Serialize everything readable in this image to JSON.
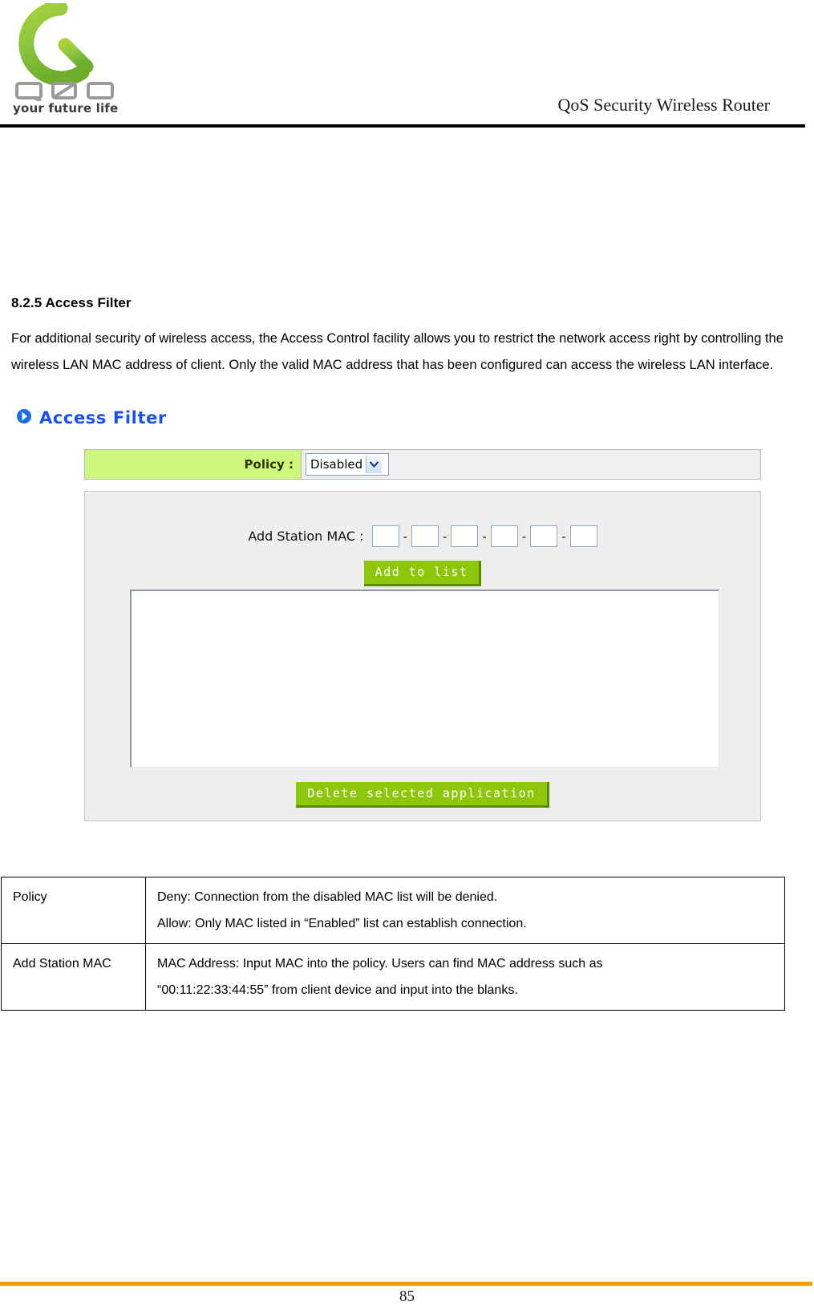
{
  "header": {
    "logo": {
      "mark_icon": "qno-q-logo-icon",
      "wordmark": "QNO",
      "tagline": "your future life"
    },
    "title": "QoS Security Wireless Router"
  },
  "section": {
    "number_title": "8.2.5 Access Filter",
    "paragraph": "For additional security of wireless access, the Access Control facility allows you to restrict the network access right by controlling the wireless LAN MAC address of client. Only the valid MAC address that has been configured can access the wireless LAN interface."
  },
  "ui_screenshot": {
    "heading": "Access Filter",
    "heading_icon": "blue-arrow-bullet-icon",
    "policy": {
      "label": "Policy :",
      "selected_value": "Disabled",
      "dropdown_icon": "chevron-down-icon"
    },
    "add_station": {
      "label": "Add Station MAC :",
      "separator": "-",
      "field_count": 6,
      "fields": [
        "",
        "",
        "",
        "",
        "",
        ""
      ],
      "add_button": "Add to list"
    },
    "mac_list": {
      "items": []
    },
    "delete_button": "Delete selected application"
  },
  "description_table": {
    "rows": [
      {
        "key": "Policy",
        "lines": [
          "Deny: Connection from the disabled MAC list will be denied.",
          "Allow: Only MAC listed in “Enabled” list can establish connection."
        ]
      },
      {
        "key": "Add Station MAC",
        "lines": [
          "MAC Address: Input MAC into the policy. Users can find MAC address such as",
          "“00:11:22:33:44:55” from client device and input into the blanks."
        ]
      }
    ]
  },
  "footer": {
    "page_number": "85"
  },
  "colors": {
    "brand_green": "#8dc60b",
    "policy_label_green": "#ccf77a",
    "heading_blue": "#1a4ff0",
    "footer_orange": "#f79b0c"
  }
}
